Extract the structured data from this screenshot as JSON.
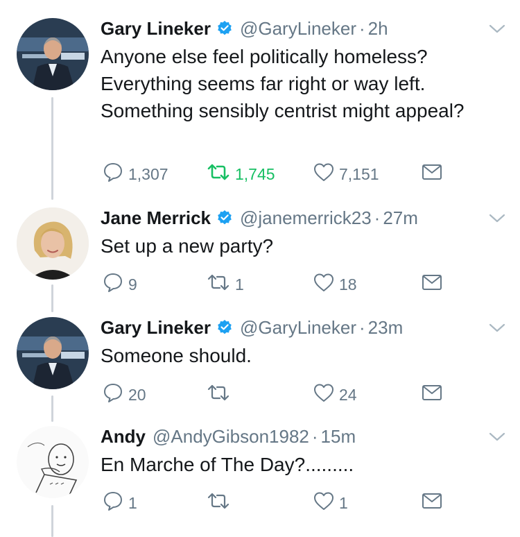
{
  "tweets": [
    {
      "name": "Gary Lineker",
      "verified": true,
      "handle": "@GaryLineker",
      "separator": "·",
      "time": "2h",
      "text": "Anyone else feel politically homeless? Everything seems far right or way left. Something sensibly centrist might appeal?",
      "replies": "1,307",
      "retweets": "1,745",
      "likes": "7,151",
      "retweeted": true
    },
    {
      "name": "Jane Merrick",
      "verified": true,
      "handle": "@janemerrick23",
      "separator": "·",
      "time": "27m",
      "text": "Set up a new party?",
      "replies": "9",
      "retweets": "1",
      "likes": "18",
      "retweeted": false
    },
    {
      "name": "Gary Lineker",
      "verified": true,
      "handle": "@GaryLineker",
      "separator": "·",
      "time": "23m",
      "text": "Someone should.",
      "replies": "20",
      "retweets": "",
      "likes": "24",
      "retweeted": false
    },
    {
      "name": "Andy",
      "verified": false,
      "handle": "@AndyGibson1982",
      "separator": "·",
      "time": "15m",
      "text": "En Marche of The Day?.........",
      "replies": "1",
      "retweets": "",
      "likes": "1",
      "retweeted": false
    }
  ],
  "icons": {
    "reply": "reply-icon",
    "retweet": "retweet-icon",
    "like": "like-icon",
    "dm": "direct-message-icon",
    "verified": "verified-badge-icon",
    "more": "chevron-down-icon"
  },
  "colors": {
    "text": "#14171a",
    "secondary": "#657786",
    "verified": "#1da1f2",
    "retweet_active": "#17bf63"
  }
}
